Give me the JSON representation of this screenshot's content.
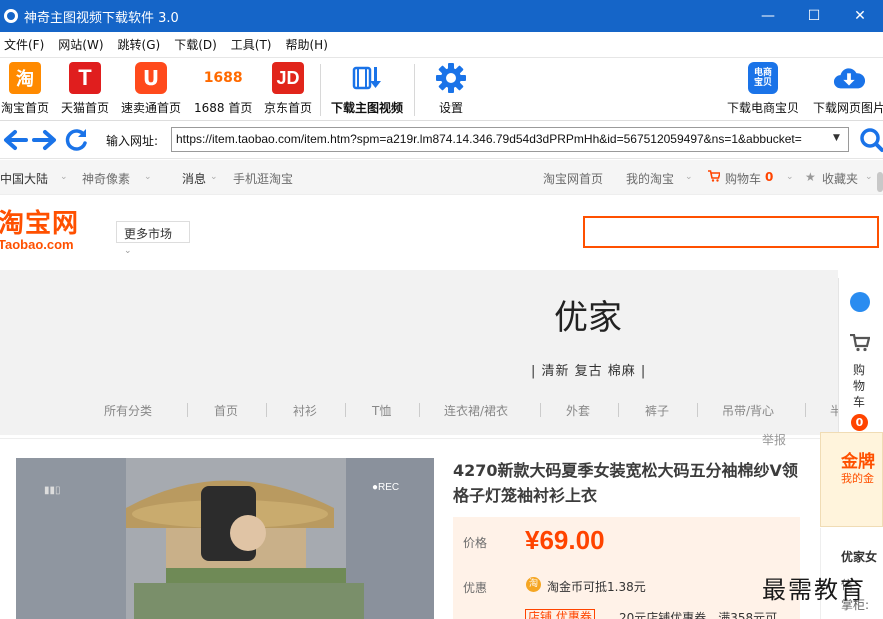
{
  "window": {
    "title": "神奇主图视频下载软件 3.0",
    "controls": {
      "minimize": "—",
      "maximize": "☐",
      "close": "✕"
    }
  },
  "menu": {
    "items": [
      "文件(F)",
      "网站(W)",
      "跳转(G)",
      "下载(D)",
      "工具(T)",
      "帮助(H)"
    ]
  },
  "toolbar": {
    "taobao": {
      "icon_text": "淘",
      "label": "淘宝首页"
    },
    "tmall": {
      "icon_text": "T",
      "label": "天猫首页"
    },
    "aliexpress": {
      "icon_text": "U",
      "label": "速卖通首页"
    },
    "c1688": {
      "icon_text": "1688",
      "label": "1688 首页"
    },
    "jd": {
      "icon_text": "JD",
      "label": "京东首页"
    },
    "download_video": {
      "label": "下载主图视频"
    },
    "settings": {
      "label": "设置"
    },
    "download_ecom": {
      "icon_text": "电商宝贝",
      "label": "下载电商宝贝"
    },
    "download_page_images": {
      "label": "下载网页图片"
    }
  },
  "address": {
    "label": "输入网址:",
    "url": "https://item.taobao.com/item.htm?spm=a219r.lm874.14.346.79d54d3dPRPmHh&id=567512059497&ns=1&abbucket=",
    "dropdown": "▼"
  },
  "site_nav": {
    "region": "中国大陆",
    "shenqi": "神奇像素",
    "message": "消息",
    "mobile": "手机逛淘宝",
    "home": "淘宝网首页",
    "mytaobao": "我的淘宝",
    "cart_label": "购物车",
    "cart_count": "0",
    "favorites": "收藏夹"
  },
  "taobao_header": {
    "logo_cn": "淘宝网",
    "logo_en": "Taobao.com",
    "more_markets": "更多市场"
  },
  "store_banner": {
    "brand": "优家",
    "slogan": "| 清新 复古 棉麻 |",
    "categories": [
      "所有分类",
      "首页",
      "衬衫",
      "T恤",
      "连衣裙/裙衣",
      "外套",
      "裤子",
      "吊带/背心",
      "半"
    ]
  },
  "right_sidebar": {
    "cart_text": "购物车",
    "cart_count": "0"
  },
  "report": "举报",
  "product": {
    "title": "4270新款大码夏季女装宽松大码五分袖棉纱V领格子灯笼袖衬衫上衣",
    "price_label": "价格",
    "price": "¥69.00",
    "discount_label": "优惠",
    "coin_text": "淘金币可抵1.38元",
    "shop_coupon_label": "店铺 优惠券",
    "coupon_text": "20元店铺优惠券，满358元可",
    "video_rec": "●REC"
  },
  "side_panel": {
    "gold_title": "金牌",
    "gold_sub": "我的金",
    "shop_name": "优家女",
    "shop_label_1": "信",
    "shop_label_2": "掌柜:"
  },
  "watermark": "最需教育",
  "colors": {
    "titlebar": "#1565c8",
    "taobao_orange": "#ff5000",
    "price_red": "#ff4400",
    "accent_blue": "#1a73e8"
  }
}
